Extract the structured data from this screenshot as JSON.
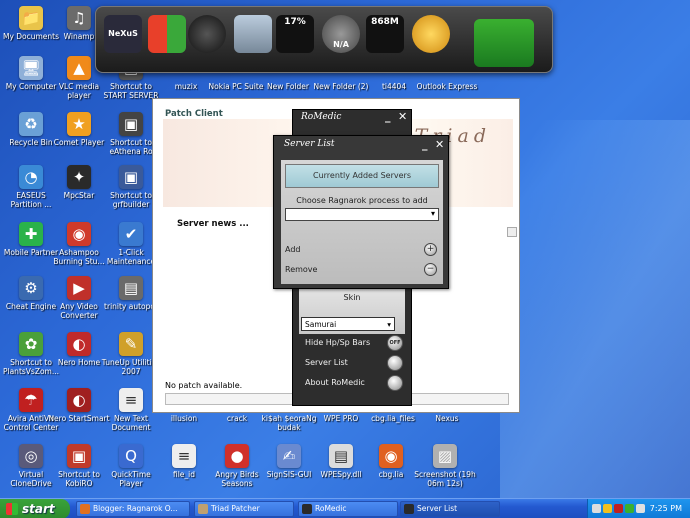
{
  "desktop_icons": [
    {
      "label": "My Documents",
      "glyph": "📁",
      "color": "#e9c44a"
    },
    {
      "label": "Winamp",
      "glyph": "♫",
      "color": "#6b6b6b"
    },
    {
      "label": "My Computer",
      "glyph": "🖥",
      "color": "#8fb0d8"
    },
    {
      "label": "VLC media player",
      "glyph": "▲",
      "color": "#f08a1a"
    },
    {
      "label": "Shortcut to START SERVER",
      "glyph": "▣",
      "color": "#555"
    },
    {
      "label": "Recycle Bin",
      "glyph": "♻",
      "color": "#6aa0d6"
    },
    {
      "label": "Comet Player",
      "glyph": "★",
      "color": "#f0a020"
    },
    {
      "label": "Shortcut to eAthena Ro",
      "glyph": "▣",
      "color": "#444"
    },
    {
      "label": "EASEUS Partition ...",
      "glyph": "◔",
      "color": "#3a8ad6"
    },
    {
      "label": "MpcStar",
      "glyph": "✦",
      "color": "#2a2a2a"
    },
    {
      "label": "Shortcut to grfbuilder",
      "glyph": "▣",
      "color": "#3a5a9a"
    },
    {
      "label": "Mobile Partner",
      "glyph": "✚",
      "color": "#2ab24a"
    },
    {
      "label": "Ashampoo Burning Stu...",
      "glyph": "◉",
      "color": "#d03a2a"
    },
    {
      "label": "1-Click Maintenance",
      "glyph": "✔",
      "color": "#3a7ad0"
    },
    {
      "label": "Cheat Engine",
      "glyph": "⚙",
      "color": "#3a6ab0"
    },
    {
      "label": "Any Video Converter",
      "glyph": "▶",
      "color": "#c0302a"
    },
    {
      "label": "trinity autopot",
      "glyph": "▤",
      "color": "#6a6a6a"
    },
    {
      "label": "Shortcut to PlantsVsZom...",
      "glyph": "✿",
      "color": "#4aa03a"
    },
    {
      "label": "Nero Home",
      "glyph": "◐",
      "color": "#c02a2a"
    },
    {
      "label": "TuneUp Utilities 2007",
      "glyph": "✎",
      "color": "#d0a02a"
    },
    {
      "label": "Avira AntiVir Control Center",
      "glyph": "☂",
      "color": "#c02020"
    },
    {
      "label": "Nero StartSmart",
      "glyph": "◐",
      "color": "#a02020"
    },
    {
      "label": "New Text Document",
      "glyph": "≡",
      "color": "#eeeeee"
    },
    {
      "label": "Virtual CloneDrive",
      "glyph": "◎",
      "color": "#5a5a7a"
    },
    {
      "label": "Shortcut to KobiRO",
      "glyph": "▣",
      "color": "#c03a2a"
    },
    {
      "label": "QuickTime Player",
      "glyph": "Q",
      "color": "#3a6ad0"
    },
    {
      "label": "file_id",
      "glyph": "≡",
      "color": "#eeeeee"
    },
    {
      "label": "Angry Birds Seasons",
      "glyph": "●",
      "color": "#d0302a"
    },
    {
      "label": "SignSIS-GUI",
      "glyph": "✍",
      "color": "#6a8ad0"
    },
    {
      "label": "WPESpy.dll",
      "glyph": "▤",
      "color": "#dcdcdc"
    },
    {
      "label": "cbg.lia",
      "glyph": "◉",
      "color": "#e06020"
    },
    {
      "label": "Screenshot (19h 06m 12s)",
      "glyph": "▨",
      "color": "#b0b0b0"
    },
    {
      "label": "muzix",
      "glyph": "",
      "color": "#2a5fc8"
    },
    {
      "label": "Nokia PC Suite",
      "glyph": "",
      "color": "#2a5fc8"
    },
    {
      "label": "New Folder",
      "glyph": "",
      "color": "#2a5fc8"
    },
    {
      "label": "New Folder (2)",
      "glyph": "",
      "color": "#2a5fc8"
    },
    {
      "label": "ti4404",
      "glyph": "",
      "color": "#2a5fc8"
    },
    {
      "label": "Outlook Express",
      "glyph": "",
      "color": "#2a5fc8"
    },
    {
      "label": "illusion",
      "glyph": "",
      "color": "#2a5fc8"
    },
    {
      "label": "crack",
      "glyph": "",
      "color": "#2a5fc8"
    },
    {
      "label": "ki$ah $eoraNg budak",
      "glyph": "",
      "color": "#2a5fc8"
    },
    {
      "label": "WPE PRO",
      "glyph": "",
      "color": "#2a5fc8"
    },
    {
      "label": "cbg.lia_files",
      "glyph": "",
      "color": "#2a5fc8"
    },
    {
      "label": "Nexus",
      "glyph": "",
      "color": "#2a5fc8"
    }
  ],
  "dock": {
    "nexus_label": "NeXuS",
    "cpu_meter": "17%",
    "na_label": "N/A",
    "memory": "868M"
  },
  "patcher": {
    "title": "Triad Patcher",
    "tabs_label": "Patch  Client",
    "logo_text": "Triad",
    "news_heading": "Server news ...",
    "status": "No patch available."
  },
  "romedic": {
    "title": "RoMedic",
    "skin_label": "Skin",
    "skin_value": "Samurai",
    "rows": [
      {
        "label": "Hide Hp/Sp Bars",
        "toggle": "OFF"
      },
      {
        "label": "Server List",
        "toggle": ""
      },
      {
        "label": "About RoMedic",
        "toggle": ""
      }
    ]
  },
  "server_list": {
    "title": "Server List",
    "header": "Currently Added Servers",
    "choose_label": "Choose Ragnarok process to add",
    "add_label": "Add",
    "add_symbol": "+",
    "remove_label": "Remove",
    "remove_symbol": "−"
  },
  "taskbar": {
    "start_label": "start",
    "buttons": [
      {
        "label": "Blogger: Ragnarok O...",
        "color": "#e07020"
      },
      {
        "label": "Triad Patcher",
        "color": "#c0a070"
      },
      {
        "label": "RoMedic",
        "color": "#2a2a2a"
      },
      {
        "label": "Server List",
        "color": "#2a2a2a"
      }
    ],
    "clock": "7:25 PM"
  }
}
